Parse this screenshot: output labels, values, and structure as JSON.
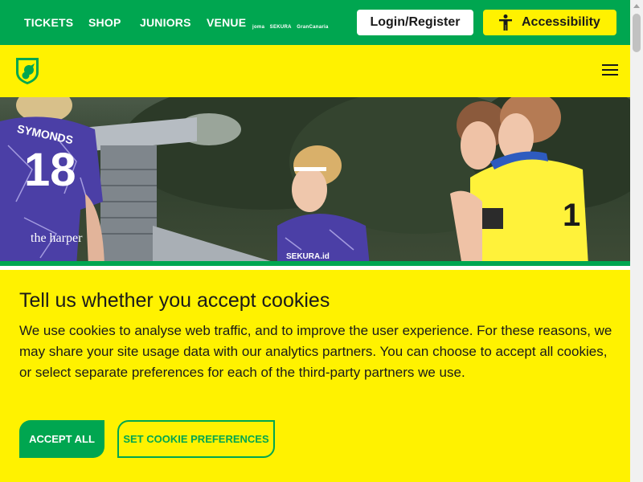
{
  "topbar": {
    "nav": [
      {
        "label": "TICKETS"
      },
      {
        "label": "SHOP"
      },
      {
        "label": "JUNIORS"
      },
      {
        "label": "VENUE"
      }
    ],
    "sponsors": [
      "joma",
      "SEKURA",
      "GranCanaria"
    ],
    "login_label": "Login/Register",
    "accessibility_label": "Accessibility",
    "accessibility_icon": "accessibility-person-icon"
  },
  "header": {
    "crest_icon": "club-crest-icon",
    "menu_icon": "hamburger-menu-icon"
  },
  "hero": {
    "shirt_number": "18",
    "shirt_name": "SYMONDS",
    "shirt_sponsor": "the harper",
    "shirt_sponsor_2": "SEKURA.id"
  },
  "cookie": {
    "title": "Tell us whether you accept cookies",
    "body": "We use cookies to analyse web traffic, and to improve the user experience. For these reasons, we may share your site usage data with our analytics partners. You can choose to accept all cookies, or select separate preferences for each of the third-party partners we use.",
    "accept_label": "ACCEPT ALL",
    "prefs_label": "SET COOKIE PREFERENCES"
  },
  "colors": {
    "green": "#00a650",
    "yellow": "#fff200",
    "kit_purple": "#4b3fa6"
  }
}
